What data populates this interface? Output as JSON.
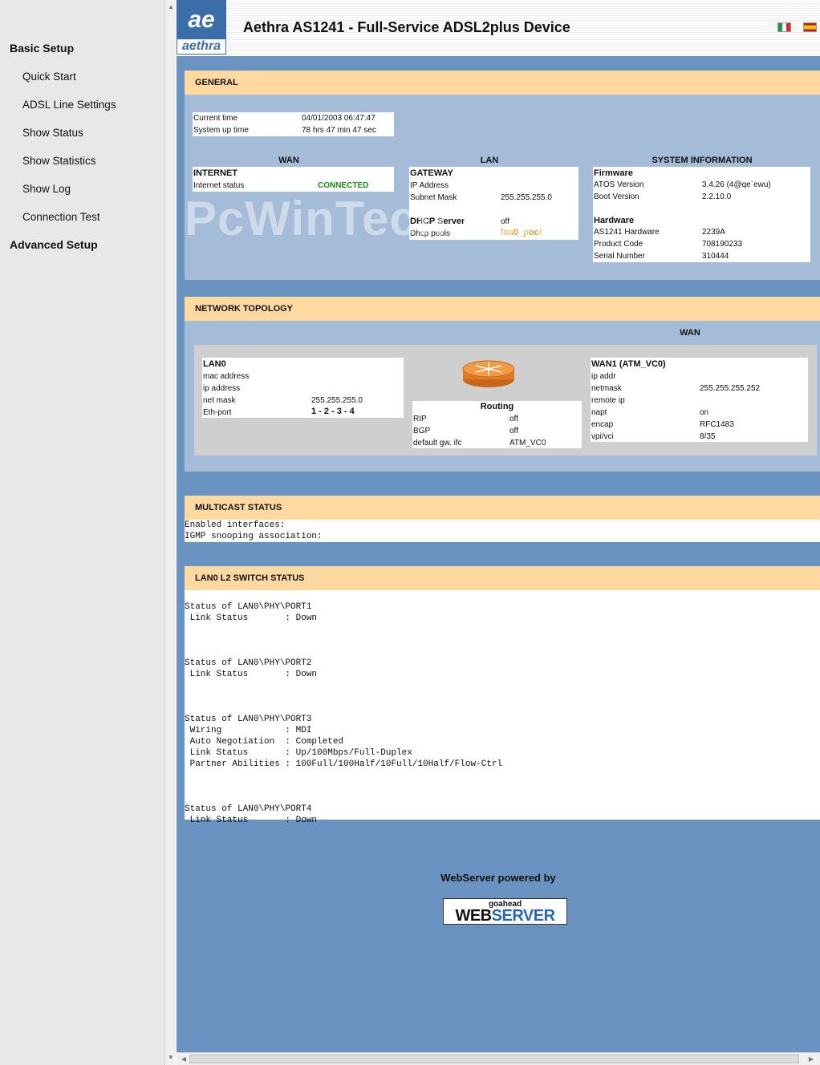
{
  "nav": {
    "basic_setup": "Basic Setup",
    "items": [
      "Quick Start",
      "ADSL Line Settings",
      "Show Status",
      "Show Statistics",
      "Show Log",
      "Connection Test"
    ],
    "advanced_setup": "Advanced Setup"
  },
  "header": {
    "logo_mark": "ae",
    "logo_text": "aethra",
    "title": "Aethra AS1241 - Full-Service ADSL2plus Device"
  },
  "general": {
    "title": "GENERAL",
    "current_time_label": "Current time",
    "current_time": "04/01/2003 06:47:47",
    "uptime_label": "System up time",
    "uptime": "78 hrs 47 min 47 sec",
    "wan_title": "WAN",
    "lan_title": "LAN",
    "sysinfo_title": "SYSTEM INFORMATION",
    "internet_title": "INTERNET",
    "internet_status_label": "Internet status",
    "internet_status": "CONNECTED",
    "gateway_title": "GATEWAY",
    "ip_address_label": "IP Address",
    "subnet_mask_label": "Subnet Mask",
    "subnet_mask": "255.255.255.0",
    "dhcp_title": "DHCP Server",
    "dhcp_value": "off",
    "dhcp_pools_label": "Dhcp pools",
    "dhcp_pools": "lan0_pool",
    "firmware_title": "Firmware",
    "atos_label": "ATOS Version",
    "atos": "3.4.26 (4@qe`ewu)",
    "boot_label": "Boot Version",
    "boot": "2.2.10.0",
    "hardware_title": "Hardware",
    "hw_label": "AS1241 Hardware",
    "hw": "2239A",
    "product_label": "Product Code",
    "product": "708190233",
    "serial_label": "Serial Number",
    "serial": "310444"
  },
  "topology": {
    "title": "NETWORK TOPOLOGY",
    "wan_title": "WAN",
    "lan0_title": "LAN0",
    "mac_label": "mac address",
    "ip_label": "ip address",
    "netmask_label": "net mask",
    "netmask": "255.255.255.0",
    "eth_label": "Eth-port",
    "eth": "1 - 2 - 3 - 4",
    "routing_title": "Routing",
    "rip_label": "RIP",
    "rip": "off",
    "bgp_label": "BGP",
    "bgp": "off",
    "gw_label": "default gw. ifc",
    "gw": "ATM_VC0",
    "wan1_title": "WAN1 (ATM_VC0)",
    "ipaddr_label": "ip addr",
    "wan_netmask_label": "netmask",
    "wan_netmask": "255.255.255.252",
    "remote_label": "remote ip",
    "napt_label": "napt",
    "napt": "on",
    "encap_label": "encap",
    "encap": "RFC1483",
    "vpi_label": "vpi/vci",
    "vpi": "8/35"
  },
  "multicast": {
    "title": "MULTICAST STATUS",
    "text": "Enabled interfaces:\nIGMP snooping association:"
  },
  "switch": {
    "title": "LAN0 L2 SWITCH STATUS",
    "text": "\nStatus of LAN0\\PHY\\PORT1\n Link Status       : Down\n\n\n\nStatus of LAN0\\PHY\\PORT2\n Link Status       : Down\n\n\n\nStatus of LAN0\\PHY\\PORT3\n Wiring            : MDI\n Auto Negotiation  : Completed\n Link Status       : Up/100Mbps/Full-Duplex\n Partner Abilities : 100Full/100Half/10Full/10Half/Flow-Ctrl\n\n\n\nStatus of LAN0\\PHY\\PORT4\n Link Status       : Down"
  },
  "watermark": "PcWinTech.com",
  "footer": {
    "powered_by": "WebServer powered by",
    "badge_small": "goahead",
    "badge_web": "WEB",
    "badge_server": "SERVER"
  },
  "colors": {
    "accent": "#3b6ea8",
    "section_header": "#ffd9a0",
    "section_body": "#a4bcd8",
    "page_bg": "#6a93c2",
    "connected": "#1a8f1a",
    "pool": "#e8961e"
  }
}
